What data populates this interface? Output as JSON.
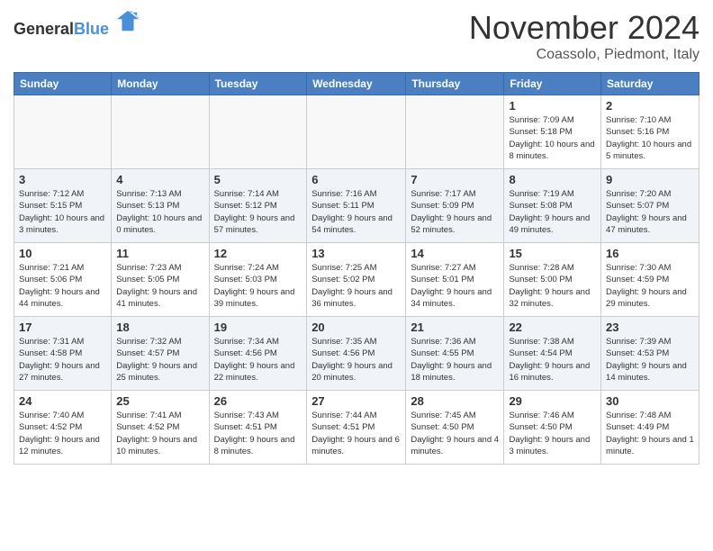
{
  "header": {
    "logo_general": "General",
    "logo_blue": "Blue",
    "month_year": "November 2024",
    "location": "Coassolo, Piedmont, Italy"
  },
  "weekdays": [
    "Sunday",
    "Monday",
    "Tuesday",
    "Wednesday",
    "Thursday",
    "Friday",
    "Saturday"
  ],
  "weeks": [
    [
      {
        "day": "",
        "info": ""
      },
      {
        "day": "",
        "info": ""
      },
      {
        "day": "",
        "info": ""
      },
      {
        "day": "",
        "info": ""
      },
      {
        "day": "",
        "info": ""
      },
      {
        "day": "1",
        "info": "Sunrise: 7:09 AM\nSunset: 5:18 PM\nDaylight: 10 hours and 8 minutes."
      },
      {
        "day": "2",
        "info": "Sunrise: 7:10 AM\nSunset: 5:16 PM\nDaylight: 10 hours and 5 minutes."
      }
    ],
    [
      {
        "day": "3",
        "info": "Sunrise: 7:12 AM\nSunset: 5:15 PM\nDaylight: 10 hours and 3 minutes."
      },
      {
        "day": "4",
        "info": "Sunrise: 7:13 AM\nSunset: 5:13 PM\nDaylight: 10 hours and 0 minutes."
      },
      {
        "day": "5",
        "info": "Sunrise: 7:14 AM\nSunset: 5:12 PM\nDaylight: 9 hours and 57 minutes."
      },
      {
        "day": "6",
        "info": "Sunrise: 7:16 AM\nSunset: 5:11 PM\nDaylight: 9 hours and 54 minutes."
      },
      {
        "day": "7",
        "info": "Sunrise: 7:17 AM\nSunset: 5:09 PM\nDaylight: 9 hours and 52 minutes."
      },
      {
        "day": "8",
        "info": "Sunrise: 7:19 AM\nSunset: 5:08 PM\nDaylight: 9 hours and 49 minutes."
      },
      {
        "day": "9",
        "info": "Sunrise: 7:20 AM\nSunset: 5:07 PM\nDaylight: 9 hours and 47 minutes."
      }
    ],
    [
      {
        "day": "10",
        "info": "Sunrise: 7:21 AM\nSunset: 5:06 PM\nDaylight: 9 hours and 44 minutes."
      },
      {
        "day": "11",
        "info": "Sunrise: 7:23 AM\nSunset: 5:05 PM\nDaylight: 9 hours and 41 minutes."
      },
      {
        "day": "12",
        "info": "Sunrise: 7:24 AM\nSunset: 5:03 PM\nDaylight: 9 hours and 39 minutes."
      },
      {
        "day": "13",
        "info": "Sunrise: 7:25 AM\nSunset: 5:02 PM\nDaylight: 9 hours and 36 minutes."
      },
      {
        "day": "14",
        "info": "Sunrise: 7:27 AM\nSunset: 5:01 PM\nDaylight: 9 hours and 34 minutes."
      },
      {
        "day": "15",
        "info": "Sunrise: 7:28 AM\nSunset: 5:00 PM\nDaylight: 9 hours and 32 minutes."
      },
      {
        "day": "16",
        "info": "Sunrise: 7:30 AM\nSunset: 4:59 PM\nDaylight: 9 hours and 29 minutes."
      }
    ],
    [
      {
        "day": "17",
        "info": "Sunrise: 7:31 AM\nSunset: 4:58 PM\nDaylight: 9 hours and 27 minutes."
      },
      {
        "day": "18",
        "info": "Sunrise: 7:32 AM\nSunset: 4:57 PM\nDaylight: 9 hours and 25 minutes."
      },
      {
        "day": "19",
        "info": "Sunrise: 7:34 AM\nSunset: 4:56 PM\nDaylight: 9 hours and 22 minutes."
      },
      {
        "day": "20",
        "info": "Sunrise: 7:35 AM\nSunset: 4:56 PM\nDaylight: 9 hours and 20 minutes."
      },
      {
        "day": "21",
        "info": "Sunrise: 7:36 AM\nSunset: 4:55 PM\nDaylight: 9 hours and 18 minutes."
      },
      {
        "day": "22",
        "info": "Sunrise: 7:38 AM\nSunset: 4:54 PM\nDaylight: 9 hours and 16 minutes."
      },
      {
        "day": "23",
        "info": "Sunrise: 7:39 AM\nSunset: 4:53 PM\nDaylight: 9 hours and 14 minutes."
      }
    ],
    [
      {
        "day": "24",
        "info": "Sunrise: 7:40 AM\nSunset: 4:52 PM\nDaylight: 9 hours and 12 minutes."
      },
      {
        "day": "25",
        "info": "Sunrise: 7:41 AM\nSunset: 4:52 PM\nDaylight: 9 hours and 10 minutes."
      },
      {
        "day": "26",
        "info": "Sunrise: 7:43 AM\nSunset: 4:51 PM\nDaylight: 9 hours and 8 minutes."
      },
      {
        "day": "27",
        "info": "Sunrise: 7:44 AM\nSunset: 4:51 PM\nDaylight: 9 hours and 6 minutes."
      },
      {
        "day": "28",
        "info": "Sunrise: 7:45 AM\nSunset: 4:50 PM\nDaylight: 9 hours and 4 minutes."
      },
      {
        "day": "29",
        "info": "Sunrise: 7:46 AM\nSunset: 4:50 PM\nDaylight: 9 hours and 3 minutes."
      },
      {
        "day": "30",
        "info": "Sunrise: 7:48 AM\nSunset: 4:49 PM\nDaylight: 9 hours and 1 minute."
      }
    ]
  ]
}
